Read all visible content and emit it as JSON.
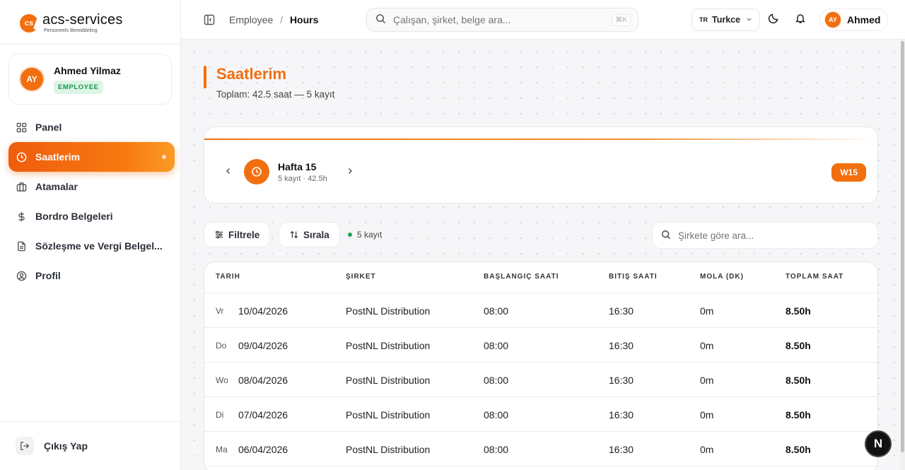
{
  "brand": {
    "mark": "cs",
    "name": "acs-services",
    "tagline": "Personeels Bemiddeling"
  },
  "user": {
    "initials": "AY",
    "name": "Ahmed Yilmaz",
    "role": "EMPLOYEE",
    "short_name": "Ahmed"
  },
  "sidebar": {
    "items": [
      {
        "label": "Panel",
        "icon": "grid-icon",
        "active": false
      },
      {
        "label": "Saatlerim",
        "icon": "clock-icon",
        "active": true
      },
      {
        "label": "Atamalar",
        "icon": "briefcase-icon",
        "active": false
      },
      {
        "label": "Bordro Belgeleri",
        "icon": "dollar-icon",
        "active": false
      },
      {
        "label": "Sözleşme ve Vergi Belgel...",
        "icon": "document-icon",
        "active": false
      },
      {
        "label": "Profil",
        "icon": "user-circle-icon",
        "active": false
      }
    ],
    "logout": "Çıkış Yap"
  },
  "header": {
    "breadcrumb": [
      "Employee",
      "Hours"
    ],
    "search_placeholder": "Çalışan, şirket, belge ara...",
    "shortcut": "⌘K",
    "lang_code": "TR",
    "lang": "Turkce"
  },
  "page": {
    "title": "Saatlerim",
    "subtitle": "Toplam: 42.5 saat — 5 kayıt"
  },
  "week": {
    "name": "Hafta 15",
    "meta": "5 kayıt · 42.5h",
    "badge": "W15"
  },
  "toolbar": {
    "filter": "Filtrele",
    "sort": "Sırala",
    "count": "5 kayıt",
    "search_placeholder": "Şirkete göre ara..."
  },
  "table": {
    "headers": [
      "TARIH",
      "ŞIRKET",
      "BAŞLANGIÇ SAATI",
      "BITIŞ SAATI",
      "MOLA (DK)",
      "TOPLAM SAAT"
    ],
    "rows": [
      {
        "day": "Vr",
        "date": "10/04/2026",
        "company": "PostNL Distribution",
        "start": "08:00",
        "end": "16:30",
        "break": "0m",
        "total": "8.50h"
      },
      {
        "day": "Do",
        "date": "09/04/2026",
        "company": "PostNL Distribution",
        "start": "08:00",
        "end": "16:30",
        "break": "0m",
        "total": "8.50h"
      },
      {
        "day": "Wo",
        "date": "08/04/2026",
        "company": "PostNL Distribution",
        "start": "08:00",
        "end": "16:30",
        "break": "0m",
        "total": "8.50h"
      },
      {
        "day": "Di",
        "date": "07/04/2026",
        "company": "PostNL Distribution",
        "start": "08:00",
        "end": "16:30",
        "break": "0m",
        "total": "8.50h"
      },
      {
        "day": "Ma",
        "date": "06/04/2026",
        "company": "PostNL Distribution",
        "start": "08:00",
        "end": "16:30",
        "break": "0m",
        "total": "8.50h"
      }
    ]
  },
  "floating": {
    "label": "N"
  },
  "colors": {
    "accent": "#f26f0f",
    "success": "#17944c"
  }
}
